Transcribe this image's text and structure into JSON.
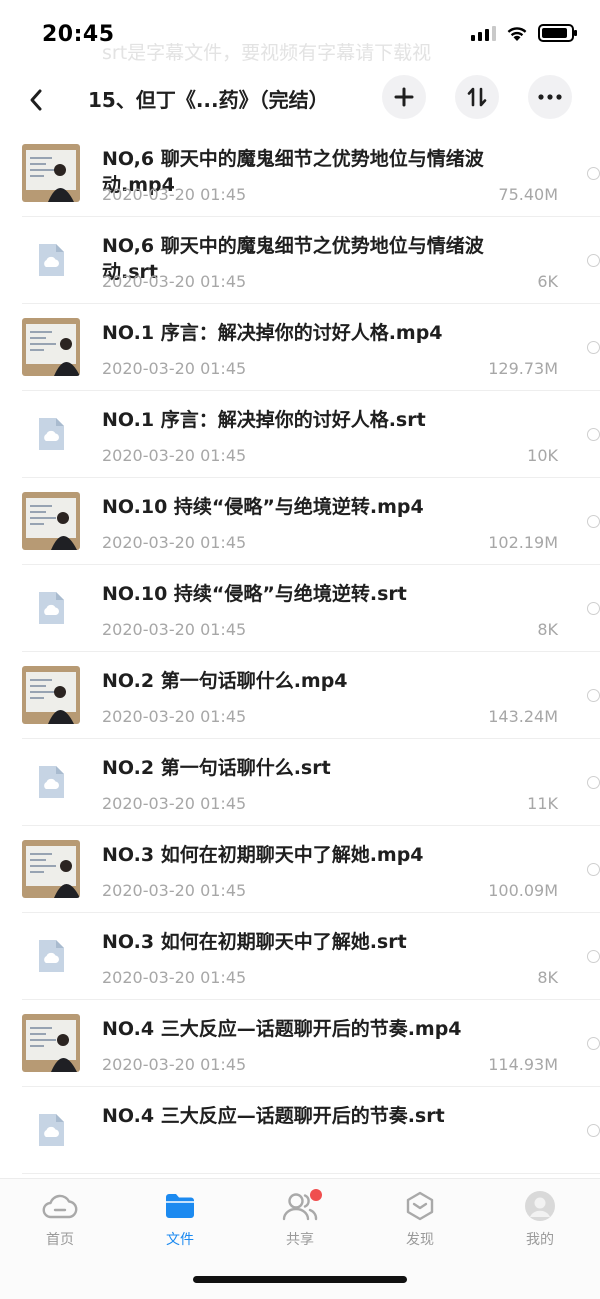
{
  "status_bar": {
    "time": "20:45",
    "battery_level": 0.9
  },
  "overlay_hint": "srt是字幕文件，要视频有字幕请下载视",
  "nav": {
    "title": "15、但丁《...药》（完结）"
  },
  "files": [
    {
      "name": "NO,6 聊天中的魔鬼细节之优势地位与情绪波动.mp4",
      "date": "2020-03-20 01:45",
      "size": "75.40M",
      "kind": "video"
    },
    {
      "name": "NO,6 聊天中的魔鬼细节之优势地位与情绪波动.srt",
      "date": "2020-03-20 01:45",
      "size": "6K",
      "kind": "document"
    },
    {
      "name": "NO.1 序言：解决掉你的讨好人格.mp4",
      "date": "2020-03-20 01:45",
      "size": "129.73M",
      "kind": "video"
    },
    {
      "name": "NO.1 序言：解决掉你的讨好人格.srt",
      "date": "2020-03-20 01:45",
      "size": "10K",
      "kind": "document"
    },
    {
      "name": "NO.10 持续“侵略”与绝境逆转.mp4",
      "date": "2020-03-20 01:45",
      "size": "102.19M",
      "kind": "video"
    },
    {
      "name": "NO.10 持续“侵略”与绝境逆转.srt",
      "date": "2020-03-20 01:45",
      "size": "8K",
      "kind": "document"
    },
    {
      "name": "NO.2 第一句话聊什么.mp4",
      "date": "2020-03-20 01:45",
      "size": "143.24M",
      "kind": "video"
    },
    {
      "name": "NO.2 第一句话聊什么.srt",
      "date": "2020-03-20 01:45",
      "size": "11K",
      "kind": "document"
    },
    {
      "name": "NO.3 如何在初期聊天中了解她.mp4",
      "date": "2020-03-20 01:45",
      "size": "100.09M",
      "kind": "video"
    },
    {
      "name": "NO.3 如何在初期聊天中了解她.srt",
      "date": "2020-03-20 01:45",
      "size": "8K",
      "kind": "document"
    },
    {
      "name": "NO.4 三大反应—话题聊开后的节奏.mp4",
      "date": "2020-03-20 01:45",
      "size": "114.93M",
      "kind": "video"
    },
    {
      "name": "NO.4 三大反应—话题聊开后的节奏.srt",
      "date": "",
      "size": "",
      "kind": "document"
    }
  ],
  "tabs": [
    {
      "label": "首页",
      "icon": "cloud-icon",
      "active": false
    },
    {
      "label": "文件",
      "icon": "folder-icon",
      "active": true
    },
    {
      "label": "共享",
      "icon": "people-icon",
      "active": false,
      "badge": true
    },
    {
      "label": "发现",
      "icon": "compass-icon",
      "active": false
    },
    {
      "label": "我的",
      "icon": "avatar-icon",
      "active": false
    }
  ],
  "colors": {
    "accent": "#1c8af0",
    "badge": "#f04e4e",
    "doc_icon": "#c6d4e4",
    "meta_text": "#a7a7a7"
  }
}
